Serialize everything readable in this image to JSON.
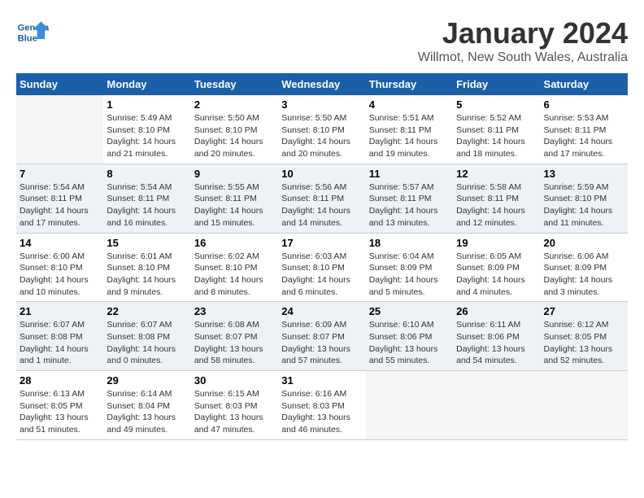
{
  "header": {
    "logo_general": "General",
    "logo_blue": "Blue",
    "month": "January 2024",
    "location": "Willmot, New South Wales, Australia"
  },
  "calendar": {
    "days_of_week": [
      "Sunday",
      "Monday",
      "Tuesday",
      "Wednesday",
      "Thursday",
      "Friday",
      "Saturday"
    ],
    "weeks": [
      [
        {
          "day": "",
          "info": ""
        },
        {
          "day": "1",
          "info": "Sunrise: 5:49 AM\nSunset: 8:10 PM\nDaylight: 14 hours\nand 21 minutes."
        },
        {
          "day": "2",
          "info": "Sunrise: 5:50 AM\nSunset: 8:10 PM\nDaylight: 14 hours\nand 20 minutes."
        },
        {
          "day": "3",
          "info": "Sunrise: 5:50 AM\nSunset: 8:10 PM\nDaylight: 14 hours\nand 20 minutes."
        },
        {
          "day": "4",
          "info": "Sunrise: 5:51 AM\nSunset: 8:11 PM\nDaylight: 14 hours\nand 19 minutes."
        },
        {
          "day": "5",
          "info": "Sunrise: 5:52 AM\nSunset: 8:11 PM\nDaylight: 14 hours\nand 18 minutes."
        },
        {
          "day": "6",
          "info": "Sunrise: 5:53 AM\nSunset: 8:11 PM\nDaylight: 14 hours\nand 17 minutes."
        }
      ],
      [
        {
          "day": "7",
          "info": "Sunrise: 5:54 AM\nSunset: 8:11 PM\nDaylight: 14 hours\nand 17 minutes."
        },
        {
          "day": "8",
          "info": "Sunrise: 5:54 AM\nSunset: 8:11 PM\nDaylight: 14 hours\nand 16 minutes."
        },
        {
          "day": "9",
          "info": "Sunrise: 5:55 AM\nSunset: 8:11 PM\nDaylight: 14 hours\nand 15 minutes."
        },
        {
          "day": "10",
          "info": "Sunrise: 5:56 AM\nSunset: 8:11 PM\nDaylight: 14 hours\nand 14 minutes."
        },
        {
          "day": "11",
          "info": "Sunrise: 5:57 AM\nSunset: 8:11 PM\nDaylight: 14 hours\nand 13 minutes."
        },
        {
          "day": "12",
          "info": "Sunrise: 5:58 AM\nSunset: 8:11 PM\nDaylight: 14 hours\nand 12 minutes."
        },
        {
          "day": "13",
          "info": "Sunrise: 5:59 AM\nSunset: 8:10 PM\nDaylight: 14 hours\nand 11 minutes."
        }
      ],
      [
        {
          "day": "14",
          "info": "Sunrise: 6:00 AM\nSunset: 8:10 PM\nDaylight: 14 hours\nand 10 minutes."
        },
        {
          "day": "15",
          "info": "Sunrise: 6:01 AM\nSunset: 8:10 PM\nDaylight: 14 hours\nand 9 minutes."
        },
        {
          "day": "16",
          "info": "Sunrise: 6:02 AM\nSunset: 8:10 PM\nDaylight: 14 hours\nand 8 minutes."
        },
        {
          "day": "17",
          "info": "Sunrise: 6:03 AM\nSunset: 8:10 PM\nDaylight: 14 hours\nand 6 minutes."
        },
        {
          "day": "18",
          "info": "Sunrise: 6:04 AM\nSunset: 8:09 PM\nDaylight: 14 hours\nand 5 minutes."
        },
        {
          "day": "19",
          "info": "Sunrise: 6:05 AM\nSunset: 8:09 PM\nDaylight: 14 hours\nand 4 minutes."
        },
        {
          "day": "20",
          "info": "Sunrise: 6:06 AM\nSunset: 8:09 PM\nDaylight: 14 hours\nand 3 minutes."
        }
      ],
      [
        {
          "day": "21",
          "info": "Sunrise: 6:07 AM\nSunset: 8:08 PM\nDaylight: 14 hours\nand 1 minute."
        },
        {
          "day": "22",
          "info": "Sunrise: 6:07 AM\nSunset: 8:08 PM\nDaylight: 14 hours\nand 0 minutes."
        },
        {
          "day": "23",
          "info": "Sunrise: 6:08 AM\nSunset: 8:07 PM\nDaylight: 13 hours\nand 58 minutes."
        },
        {
          "day": "24",
          "info": "Sunrise: 6:09 AM\nSunset: 8:07 PM\nDaylight: 13 hours\nand 57 minutes."
        },
        {
          "day": "25",
          "info": "Sunrise: 6:10 AM\nSunset: 8:06 PM\nDaylight: 13 hours\nand 55 minutes."
        },
        {
          "day": "26",
          "info": "Sunrise: 6:11 AM\nSunset: 8:06 PM\nDaylight: 13 hours\nand 54 minutes."
        },
        {
          "day": "27",
          "info": "Sunrise: 6:12 AM\nSunset: 8:05 PM\nDaylight: 13 hours\nand 52 minutes."
        }
      ],
      [
        {
          "day": "28",
          "info": "Sunrise: 6:13 AM\nSunset: 8:05 PM\nDaylight: 13 hours\nand 51 minutes."
        },
        {
          "day": "29",
          "info": "Sunrise: 6:14 AM\nSunset: 8:04 PM\nDaylight: 13 hours\nand 49 minutes."
        },
        {
          "day": "30",
          "info": "Sunrise: 6:15 AM\nSunset: 8:03 PM\nDaylight: 13 hours\nand 47 minutes."
        },
        {
          "day": "31",
          "info": "Sunrise: 6:16 AM\nSunset: 8:03 PM\nDaylight: 13 hours\nand 46 minutes."
        },
        {
          "day": "",
          "info": ""
        },
        {
          "day": "",
          "info": ""
        },
        {
          "day": "",
          "info": ""
        }
      ]
    ]
  }
}
